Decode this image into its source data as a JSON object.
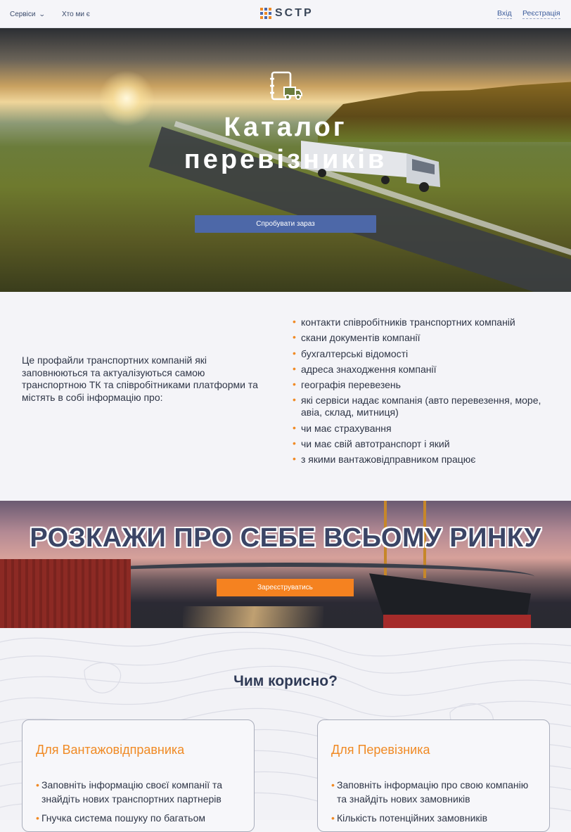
{
  "header": {
    "services_label": "Сервіси",
    "about_label": "Хто ми є",
    "logo_text": "SCTP",
    "login_label": "Вхід",
    "register_label": "Реєстрація"
  },
  "hero": {
    "title_line1": "Каталог",
    "title_line2": "перевізників",
    "cta_label": "Спробувати зараз"
  },
  "info": {
    "description": "Це профайли транспортних компаній які заповнюються та актуалізуються самою транспортною ТК та співробітниками платформи та  містять в собі інформацію про:",
    "items": [
      "контакти співробітників транспортних компаній",
      "скани документів компанії",
      "бухгалтерські відомості",
      "адреса знаходження компанії",
      "географія перевезень",
      "які сервіси надає компанія (авто перевезення, море, авіа, склад, митниця)",
      "чи має страхування",
      "чи має свій автотранспорт і який",
      "з якими вантажовідправником працює"
    ]
  },
  "banner": {
    "title": "РОЗКАЖИ ПРО СЕБЕ ВСЬОМУ РИНКУ",
    "cta_label": "Зареєструватись"
  },
  "benefits": {
    "title": "Чим корисно?",
    "cards": [
      {
        "title": "Для Вантажовідправника",
        "items": [
          "Заповніть інформацію своєї компанії та знайдіть нових транспортних партнерів",
          "Гнучка система пошуку по багатьом"
        ]
      },
      {
        "title": "Для Перевізника",
        "items": [
          "Заповніть інформацію про свою компанію та знайдіть нових замовників",
          "Кількість потенційних замовників"
        ]
      }
    ]
  },
  "colors": {
    "accent_orange": "#f58220",
    "primary_blue": "#4d68a8",
    "text_dark": "#2e3546"
  }
}
